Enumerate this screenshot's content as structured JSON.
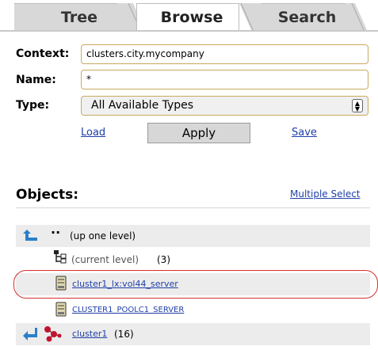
{
  "tabs": [
    {
      "label": "Tree",
      "active": false
    },
    {
      "label": "Browse",
      "active": true
    },
    {
      "label": "Search",
      "active": false
    }
  ],
  "form": {
    "context_label": "Context:",
    "context_value": "clusters.city.mycompany",
    "name_label": "Name:",
    "name_value": "*",
    "type_label": "Type:",
    "type_value": "All Available Types"
  },
  "actions": {
    "load": "Load",
    "apply": "Apply",
    "save": "Save"
  },
  "objects": {
    "title": "Objects:",
    "multiple_select": "Multiple Select",
    "items": [
      {
        "dots": "··",
        "text": "(up one level)",
        "icon": "up-arrow-icon"
      },
      {
        "text": "(current level)",
        "count": "(3)",
        "icon": "tree-structure-icon"
      },
      {
        "text": "cluster1_lx:vol44_server",
        "icon": "server-icon",
        "highlighted": true
      },
      {
        "text": "CLUSTER1_POOLC1_SERVER",
        "icon": "server-icon"
      },
      {
        "text": "cluster1",
        "count": "(16)",
        "icon": "cluster-icon"
      }
    ]
  },
  "colors": {
    "link": "#1f3fa8",
    "field_border": "#c8aa62",
    "highlight_ring": "#d43030"
  }
}
